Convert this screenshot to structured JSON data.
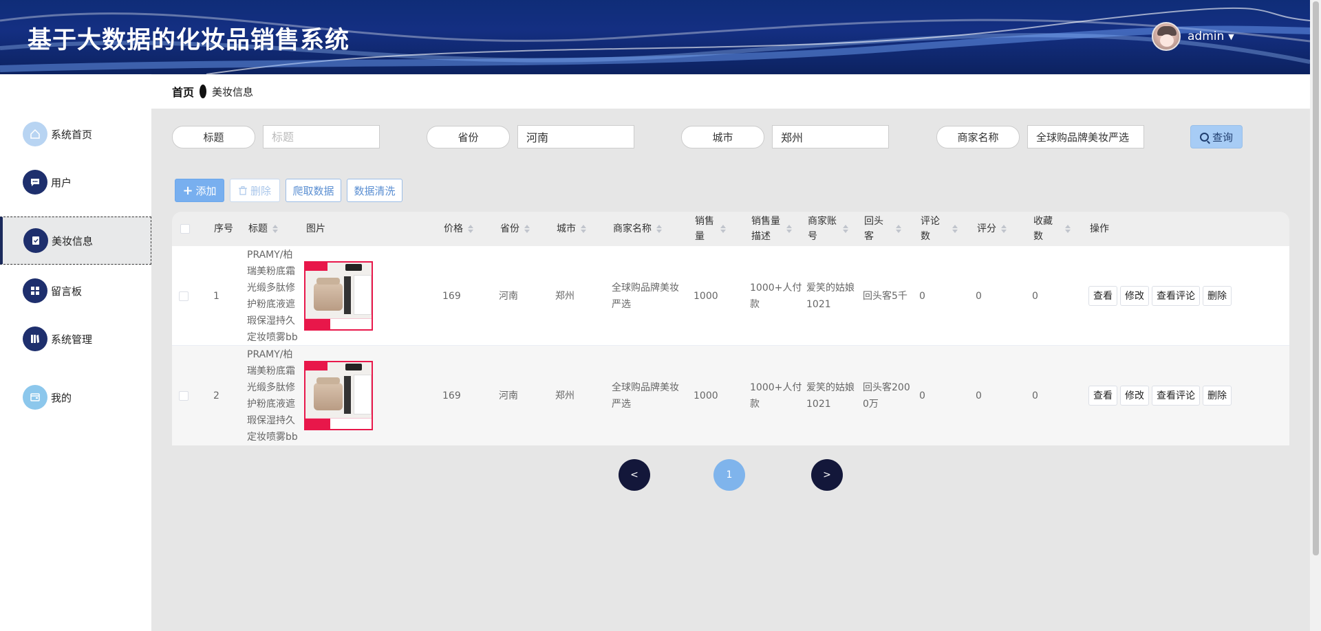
{
  "header": {
    "title": "基于大数据的化妆品销售系统",
    "username": "admin",
    "caret": "▼"
  },
  "sidebar": {
    "items": [
      {
        "label": "系统首页",
        "icon": "home-icon"
      },
      {
        "label": "用户",
        "icon": "chat-icon"
      },
      {
        "label": "美妆信息",
        "icon": "clipboard-icon"
      },
      {
        "label": "留言板",
        "icon": "grid-icon"
      },
      {
        "label": "系统管理",
        "icon": "book-icon"
      },
      {
        "label": "我的",
        "icon": "wallet-icon"
      }
    ]
  },
  "breadcrumb": {
    "home": "首页",
    "current": "美妆信息"
  },
  "search": {
    "title_label": "标题",
    "title_placeholder": "标题",
    "title_value": "",
    "province_label": "省份",
    "province_value": "河南",
    "city_label": "城市",
    "city_value": "郑州",
    "merchant_label": "商家名称",
    "merchant_value": "全球购品牌美妆严选",
    "query_label": "查询"
  },
  "actions": {
    "add": "添加",
    "delete": "删除",
    "crawl": "爬取数据",
    "clean": "数据清洗"
  },
  "table": {
    "columns": [
      "序号",
      "标题",
      "图片",
      "价格",
      "省份",
      "城市",
      "商家名称",
      "销售量",
      "销售量描述",
      "商家账号",
      "回头客",
      "评论数",
      "评分",
      "收藏数",
      "操作"
    ],
    "rows": [
      {
        "index": "1",
        "title": "PRAMY/柏瑞美粉底霜光缎多肽修护粉底液遮瑕保湿持久定妆喷雾bb",
        "price": "169",
        "province": "河南",
        "city": "郑州",
        "merchant": "全球购品牌美妆严选",
        "sales": "1000",
        "sales_desc": "1000+人付款",
        "account": "爱笑的姑娘1021",
        "repeat": "回头客5千",
        "comments": "0",
        "score": "0",
        "favorites": "0"
      },
      {
        "index": "2",
        "title": "PRAMY/柏瑞美粉底霜光缎多肽修护粉底液遮瑕保湿持久定妆喷雾bb",
        "price": "169",
        "province": "河南",
        "city": "郑州",
        "merchant": "全球购品牌美妆严选",
        "sales": "1000",
        "sales_desc": "1000+人付款",
        "account": "爱笑的姑娘1021",
        "repeat": "回头客2000万",
        "comments": "0",
        "score": "0",
        "favorites": "0"
      }
    ],
    "row_actions": [
      "查看",
      "修改",
      "查看评论",
      "删除"
    ]
  },
  "pagination": {
    "prev": "<",
    "current": "1",
    "next": ">"
  },
  "colors": {
    "header_bg": "#142f82",
    "primary": "#78afef",
    "pager_dark": "#13173a"
  }
}
